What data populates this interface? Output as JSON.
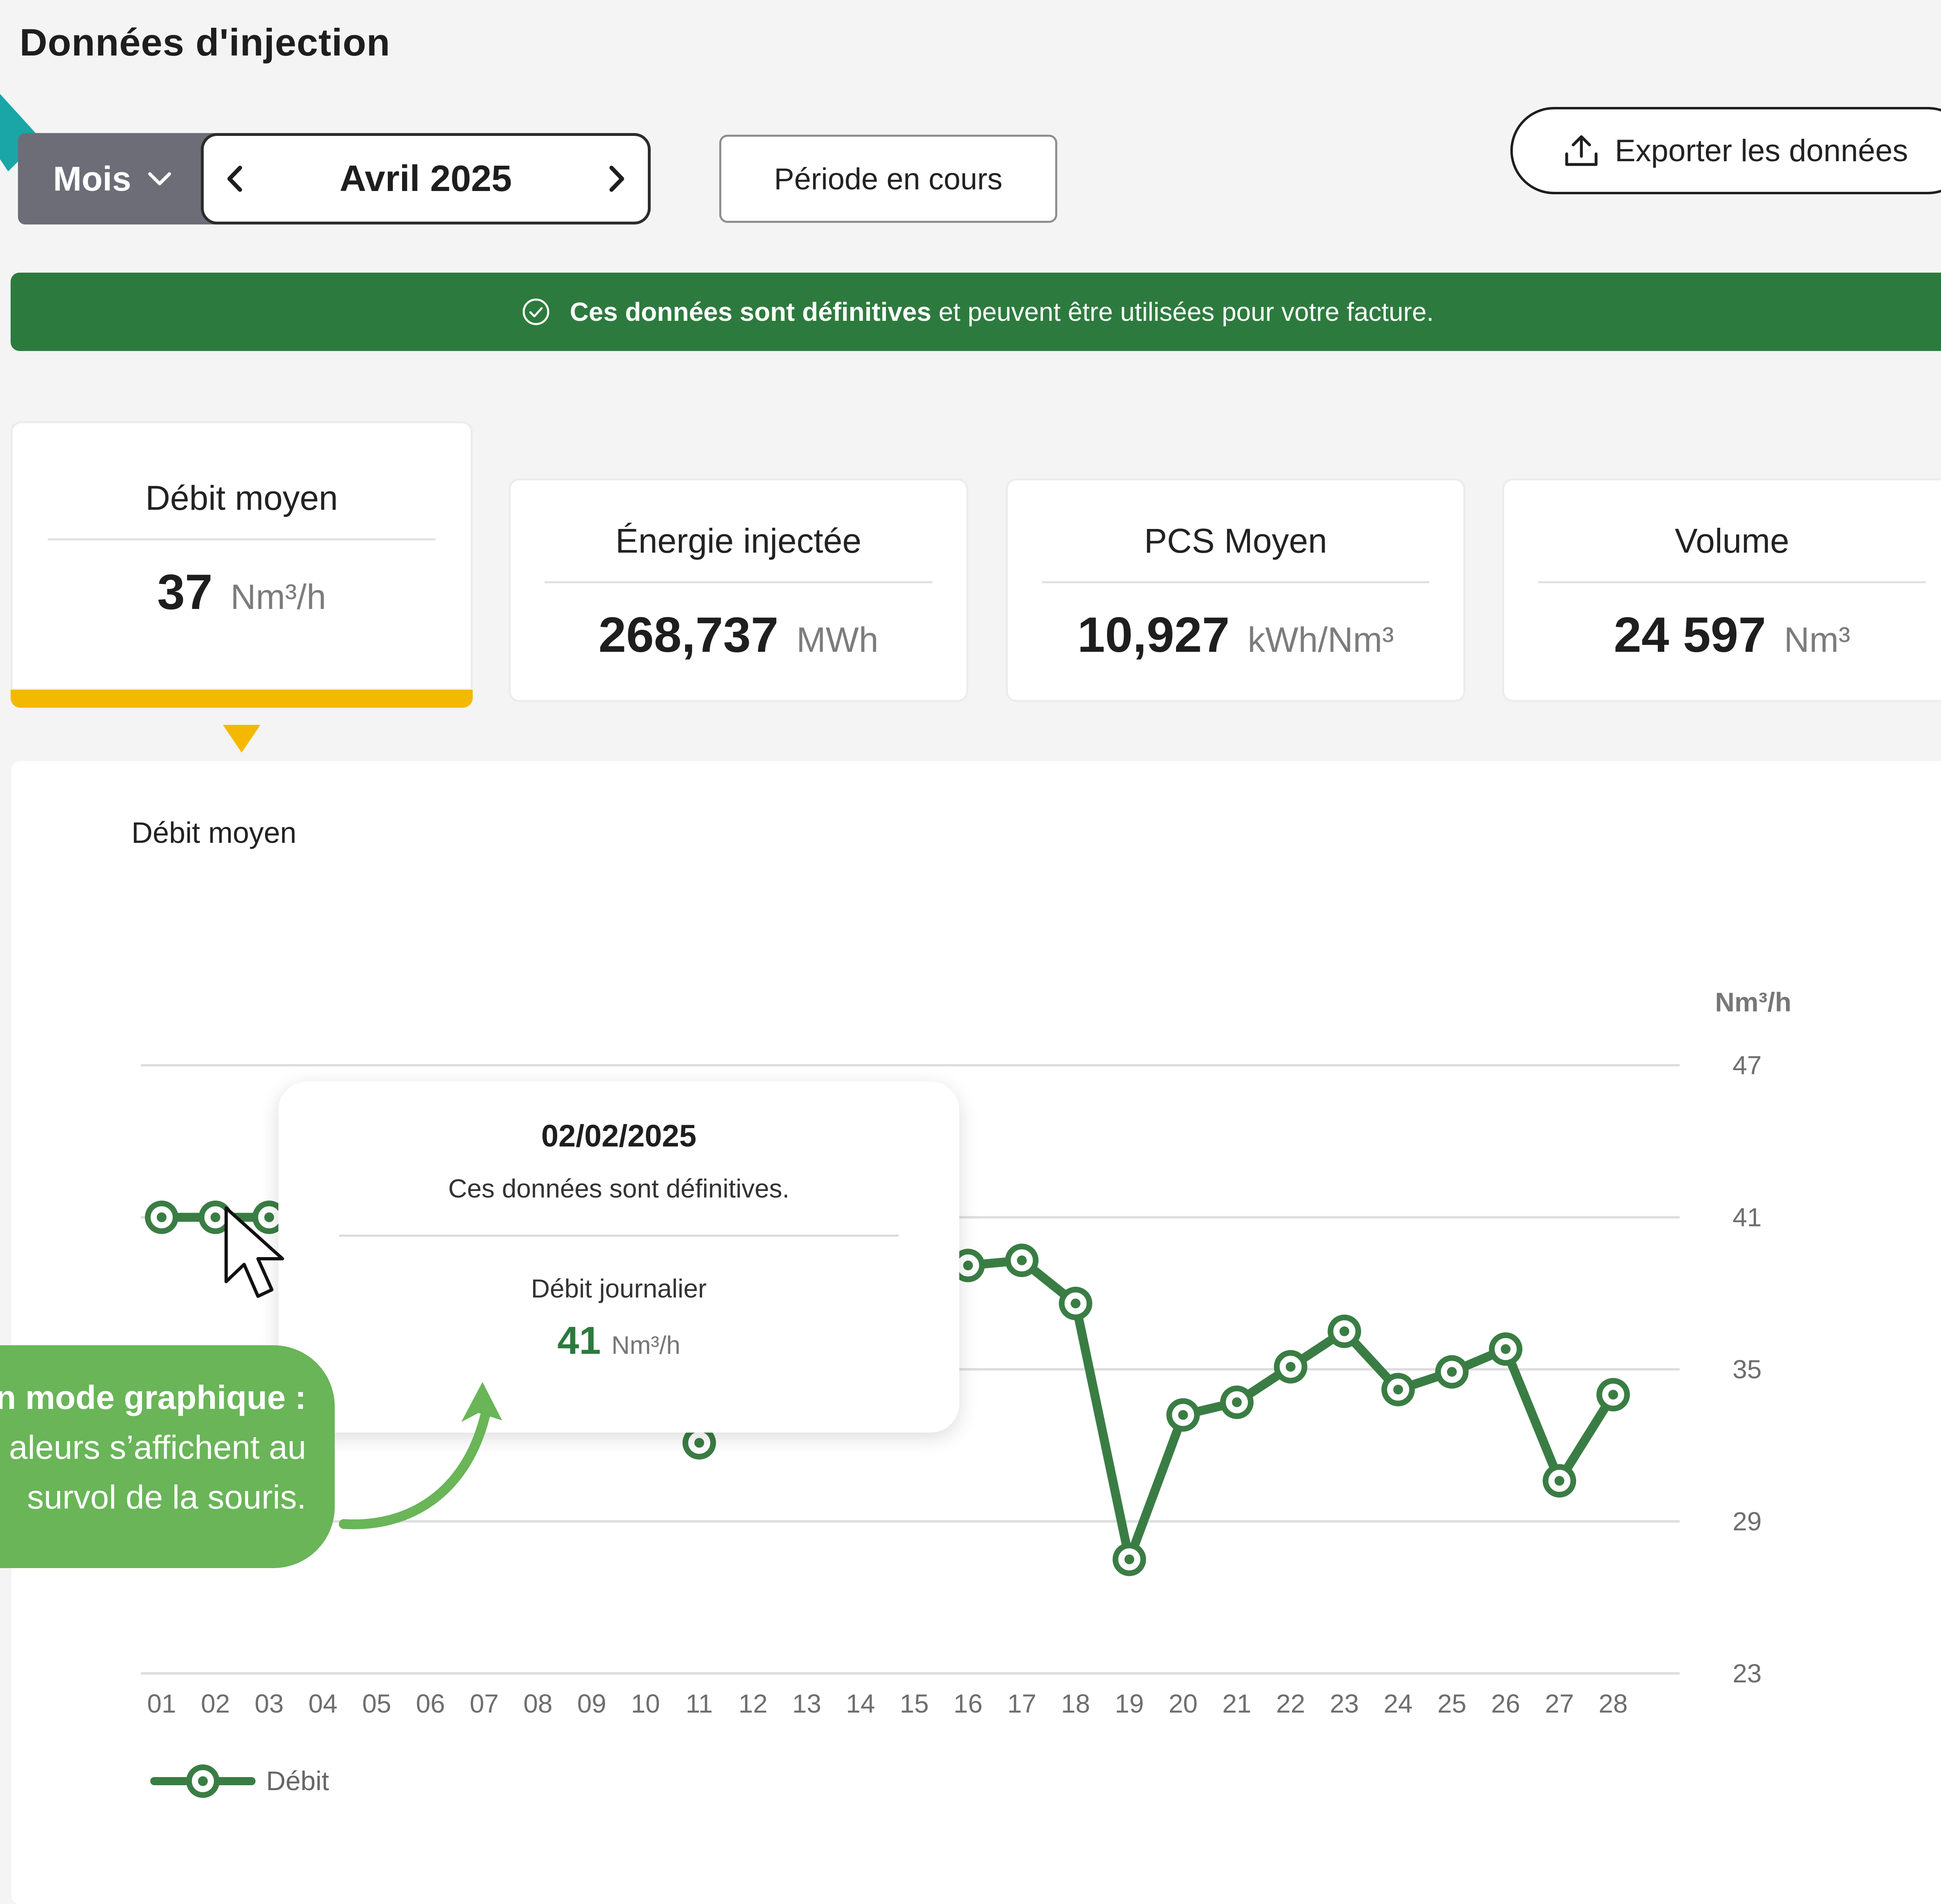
{
  "page": {
    "title": "Données d'injection"
  },
  "period_selector": {
    "type_label": "Mois",
    "current_period": "Avril 2025",
    "current_period_button": "Période en cours"
  },
  "export_button": {
    "label": "Exporter les données"
  },
  "banner": {
    "bold_text": "Ces données sont définitives",
    "rest_text": " et peuvent être utilisées pour votre facture."
  },
  "kpis": [
    {
      "label": "Débit moyen",
      "value": "37",
      "unit": "Nm³/h",
      "active": true
    },
    {
      "label": "Énergie injectée",
      "value": "268,737",
      "unit": "MWh",
      "active": false
    },
    {
      "label": "PCS Moyen",
      "value": "10,927",
      "unit": "kWh/Nm³",
      "active": false
    },
    {
      "label": "Volume",
      "value": "24 597",
      "unit": "Nm³",
      "active": false
    }
  ],
  "colors": {
    "accent_green": "#2d7a3e",
    "line_green": "#3a7d44",
    "active_yellow": "#f5b800",
    "callout_green": "#69b558",
    "teal": "#1aa6a6"
  },
  "tooltip": {
    "date": "02/02/2025",
    "status": "Ces données sont définitives.",
    "label": "Débit journalier",
    "value": "41",
    "unit": "Nm³/h"
  },
  "callout": {
    "line1": "n mode graphique :",
    "line2": "aleurs s’affichent au",
    "line3": "survol de la souris."
  },
  "chart_data": {
    "type": "line",
    "title": "Débit moyen",
    "ylabel": "Nm³/h",
    "ylim": [
      23,
      47
    ],
    "yticks": [
      "47",
      "41",
      "35",
      "29",
      "23"
    ],
    "categories": [
      "01",
      "02",
      "03",
      "04",
      "05",
      "06",
      "07",
      "08",
      "09",
      "10",
      "11",
      "12",
      "13",
      "14",
      "15",
      "16",
      "17",
      "18",
      "19",
      "20",
      "21",
      "22",
      "23",
      "24",
      "25",
      "26",
      "27",
      "28"
    ],
    "visible_points": [
      {
        "x": "01",
        "y": 41
      },
      {
        "x": "02",
        "y": 41
      },
      {
        "x": "03",
        "y": 41
      },
      {
        "x": "11",
        "y": 32.1
      },
      {
        "x": "16",
        "y": 39.1
      },
      {
        "x": "17",
        "y": 39.3
      },
      {
        "x": "18",
        "y": 37.6
      },
      {
        "x": "19",
        "y": 27.5
      },
      {
        "x": "20",
        "y": 33.2
      },
      {
        "x": "21",
        "y": 33.7
      },
      {
        "x": "22",
        "y": 35.1
      },
      {
        "x": "23",
        "y": 36.5
      },
      {
        "x": "24",
        "y": 34.2
      },
      {
        "x": "25",
        "y": 34.9
      },
      {
        "x": "26",
        "y": 35.8
      },
      {
        "x": "27",
        "y": 30.6
      },
      {
        "x": "28",
        "y": 34.0
      }
    ],
    "series": [
      {
        "name": "Débit"
      }
    ],
    "grid": true,
    "legend": "bottom-left"
  }
}
